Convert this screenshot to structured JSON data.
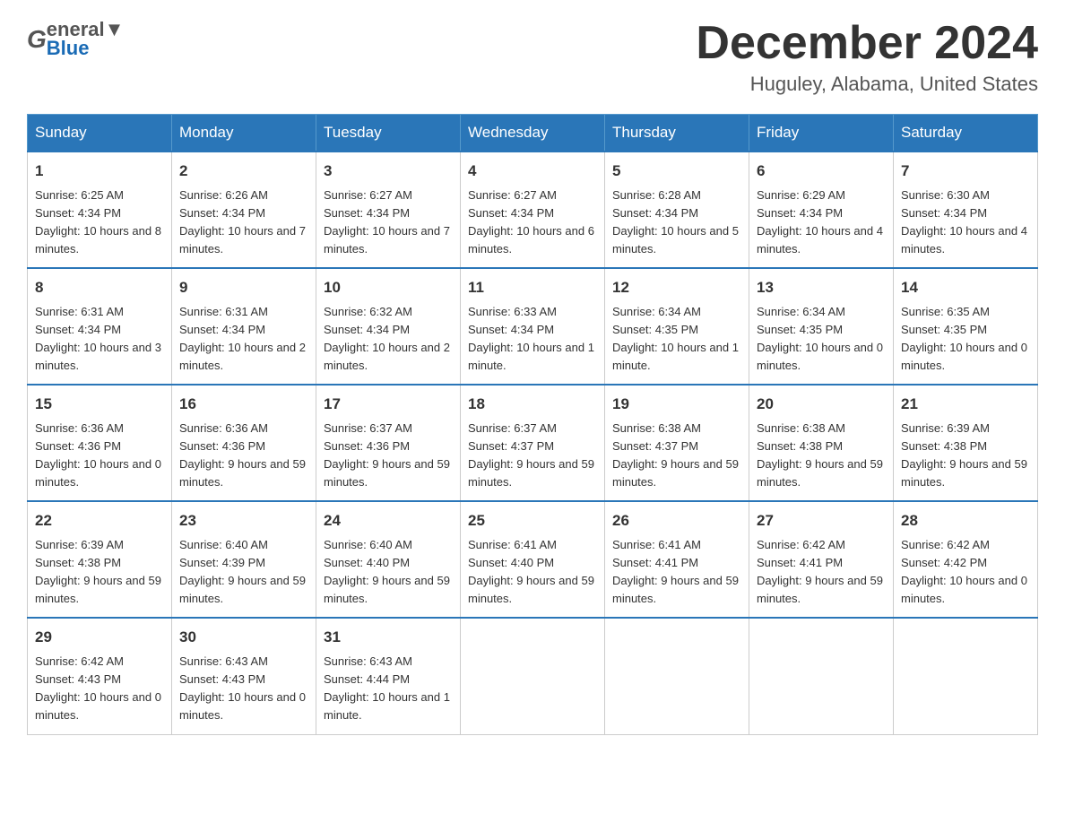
{
  "header": {
    "logo_general": "General",
    "logo_blue": "Blue",
    "title": "December 2024",
    "subtitle": "Huguley, Alabama, United States"
  },
  "calendar": {
    "days": [
      "Sunday",
      "Monday",
      "Tuesday",
      "Wednesday",
      "Thursday",
      "Friday",
      "Saturday"
    ],
    "weeks": [
      [
        {
          "date": "1",
          "sunrise": "6:25 AM",
          "sunset": "4:34 PM",
          "daylight": "10 hours and 8 minutes."
        },
        {
          "date": "2",
          "sunrise": "6:26 AM",
          "sunset": "4:34 PM",
          "daylight": "10 hours and 7 minutes."
        },
        {
          "date": "3",
          "sunrise": "6:27 AM",
          "sunset": "4:34 PM",
          "daylight": "10 hours and 7 minutes."
        },
        {
          "date": "4",
          "sunrise": "6:27 AM",
          "sunset": "4:34 PM",
          "daylight": "10 hours and 6 minutes."
        },
        {
          "date": "5",
          "sunrise": "6:28 AM",
          "sunset": "4:34 PM",
          "daylight": "10 hours and 5 minutes."
        },
        {
          "date": "6",
          "sunrise": "6:29 AM",
          "sunset": "4:34 PM",
          "daylight": "10 hours and 4 minutes."
        },
        {
          "date": "7",
          "sunrise": "6:30 AM",
          "sunset": "4:34 PM",
          "daylight": "10 hours and 4 minutes."
        }
      ],
      [
        {
          "date": "8",
          "sunrise": "6:31 AM",
          "sunset": "4:34 PM",
          "daylight": "10 hours and 3 minutes."
        },
        {
          "date": "9",
          "sunrise": "6:31 AM",
          "sunset": "4:34 PM",
          "daylight": "10 hours and 2 minutes."
        },
        {
          "date": "10",
          "sunrise": "6:32 AM",
          "sunset": "4:34 PM",
          "daylight": "10 hours and 2 minutes."
        },
        {
          "date": "11",
          "sunrise": "6:33 AM",
          "sunset": "4:34 PM",
          "daylight": "10 hours and 1 minute."
        },
        {
          "date": "12",
          "sunrise": "6:34 AM",
          "sunset": "4:35 PM",
          "daylight": "10 hours and 1 minute."
        },
        {
          "date": "13",
          "sunrise": "6:34 AM",
          "sunset": "4:35 PM",
          "daylight": "10 hours and 0 minutes."
        },
        {
          "date": "14",
          "sunrise": "6:35 AM",
          "sunset": "4:35 PM",
          "daylight": "10 hours and 0 minutes."
        }
      ],
      [
        {
          "date": "15",
          "sunrise": "6:36 AM",
          "sunset": "4:36 PM",
          "daylight": "10 hours and 0 minutes."
        },
        {
          "date": "16",
          "sunrise": "6:36 AM",
          "sunset": "4:36 PM",
          "daylight": "9 hours and 59 minutes."
        },
        {
          "date": "17",
          "sunrise": "6:37 AM",
          "sunset": "4:36 PM",
          "daylight": "9 hours and 59 minutes."
        },
        {
          "date": "18",
          "sunrise": "6:37 AM",
          "sunset": "4:37 PM",
          "daylight": "9 hours and 59 minutes."
        },
        {
          "date": "19",
          "sunrise": "6:38 AM",
          "sunset": "4:37 PM",
          "daylight": "9 hours and 59 minutes."
        },
        {
          "date": "20",
          "sunrise": "6:38 AM",
          "sunset": "4:38 PM",
          "daylight": "9 hours and 59 minutes."
        },
        {
          "date": "21",
          "sunrise": "6:39 AM",
          "sunset": "4:38 PM",
          "daylight": "9 hours and 59 minutes."
        }
      ],
      [
        {
          "date": "22",
          "sunrise": "6:39 AM",
          "sunset": "4:38 PM",
          "daylight": "9 hours and 59 minutes."
        },
        {
          "date": "23",
          "sunrise": "6:40 AM",
          "sunset": "4:39 PM",
          "daylight": "9 hours and 59 minutes."
        },
        {
          "date": "24",
          "sunrise": "6:40 AM",
          "sunset": "4:40 PM",
          "daylight": "9 hours and 59 minutes."
        },
        {
          "date": "25",
          "sunrise": "6:41 AM",
          "sunset": "4:40 PM",
          "daylight": "9 hours and 59 minutes."
        },
        {
          "date": "26",
          "sunrise": "6:41 AM",
          "sunset": "4:41 PM",
          "daylight": "9 hours and 59 minutes."
        },
        {
          "date": "27",
          "sunrise": "6:42 AM",
          "sunset": "4:41 PM",
          "daylight": "9 hours and 59 minutes."
        },
        {
          "date": "28",
          "sunrise": "6:42 AM",
          "sunset": "4:42 PM",
          "daylight": "10 hours and 0 minutes."
        }
      ],
      [
        {
          "date": "29",
          "sunrise": "6:42 AM",
          "sunset": "4:43 PM",
          "daylight": "10 hours and 0 minutes."
        },
        {
          "date": "30",
          "sunrise": "6:43 AM",
          "sunset": "4:43 PM",
          "daylight": "10 hours and 0 minutes."
        },
        {
          "date": "31",
          "sunrise": "6:43 AM",
          "sunset": "4:44 PM",
          "daylight": "10 hours and 1 minute."
        },
        null,
        null,
        null,
        null
      ]
    ]
  }
}
